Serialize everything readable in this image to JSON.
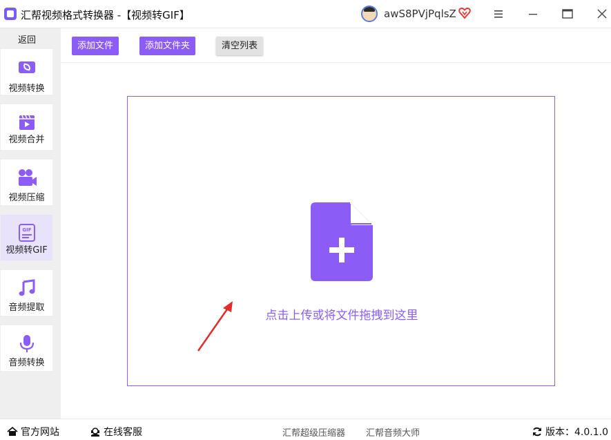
{
  "titlebar": {
    "app_title": "汇帮视频格式转换器 -【视频转GIF】",
    "username": "awS8PVjPqlsZ"
  },
  "sidebar": {
    "back_label": "返回",
    "items": [
      {
        "label": "视频转换",
        "icon": "video-convert-icon"
      },
      {
        "label": "视频合并",
        "icon": "video-merge-icon"
      },
      {
        "label": "视频压缩",
        "icon": "video-compress-icon"
      },
      {
        "label": "视频转GIF",
        "icon": "gif-icon",
        "active": true
      },
      {
        "label": "音频提取",
        "icon": "music-note-icon"
      },
      {
        "label": "音频转换",
        "icon": "microphone-icon"
      }
    ]
  },
  "toolbar": {
    "add_file": "添加文件",
    "add_folder": "添加文件夹",
    "clear_list": "清空列表"
  },
  "dropzone": {
    "hint": "点击上传或将文件拖拽到这里"
  },
  "footer": {
    "official_site": "官方网站",
    "online_service": "在线客服",
    "link_compressor": "汇帮超级压缩器",
    "link_audio": "汇帮音频大师",
    "version": "版本：4.0.1.0"
  },
  "colors": {
    "accent": "#8b5cf6",
    "sidebar_bg": "#efefef",
    "active_bg": "#e9e2fb"
  }
}
